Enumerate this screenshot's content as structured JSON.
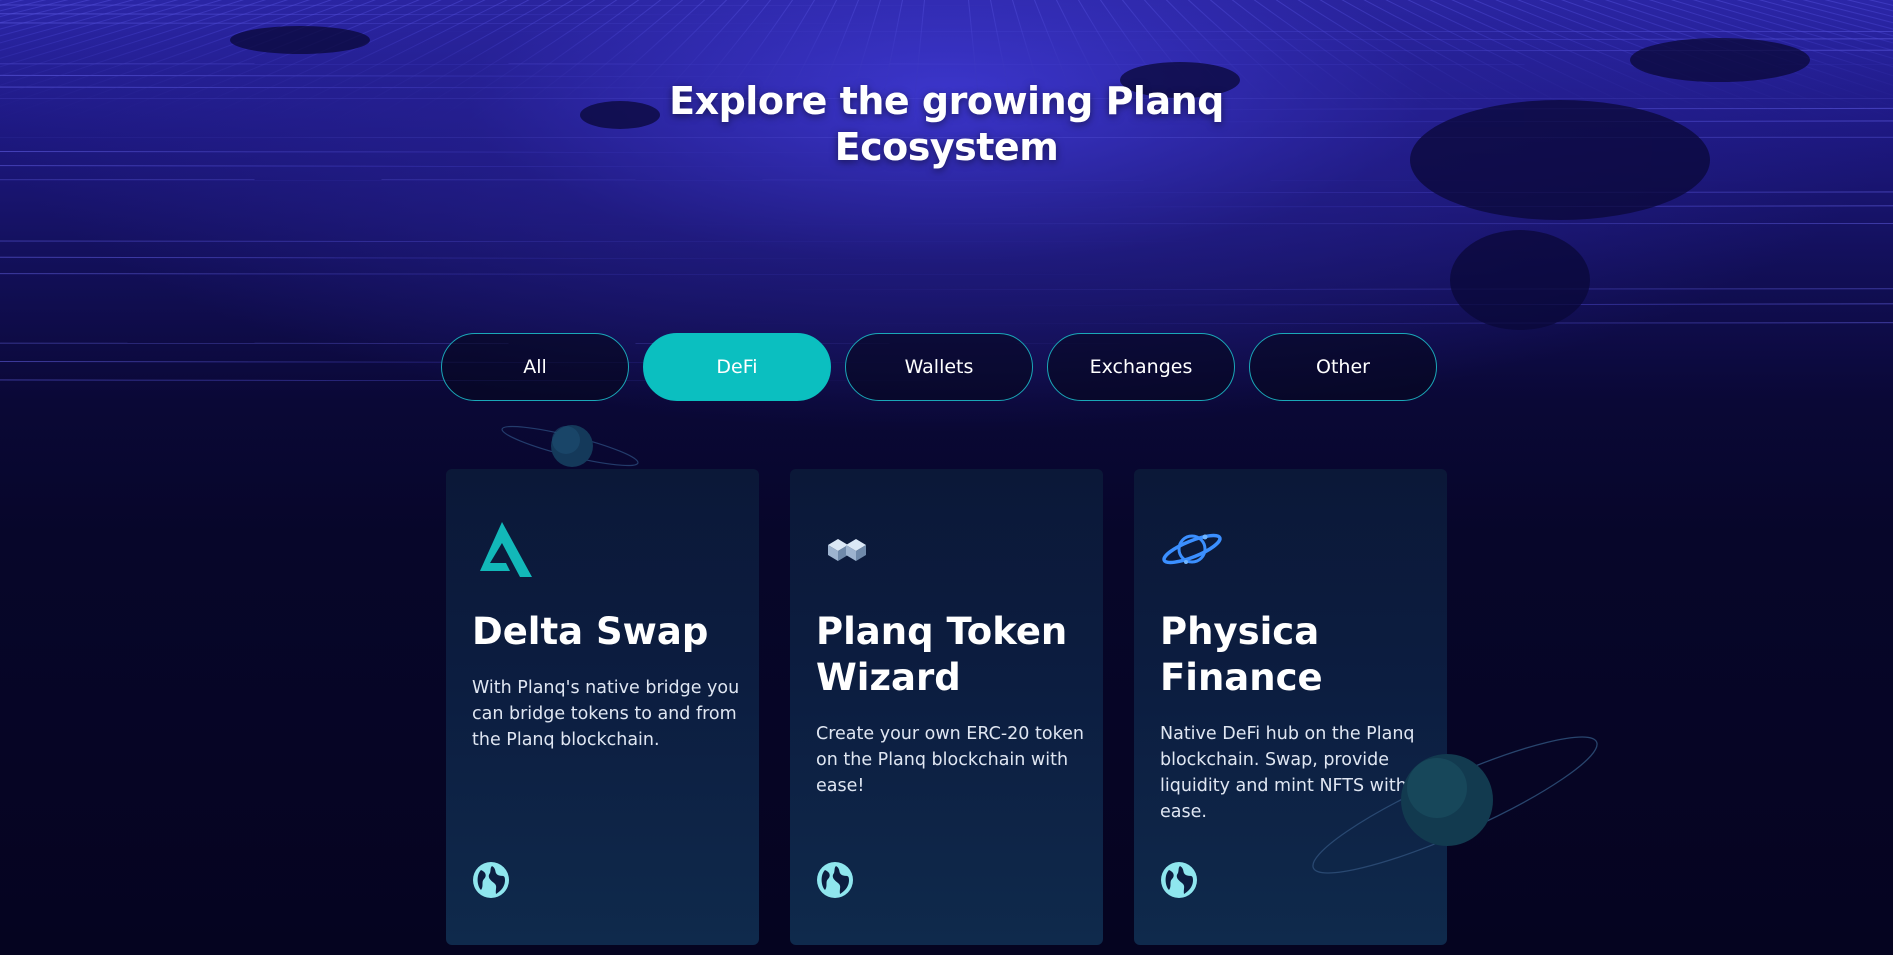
{
  "hero": {
    "title_line1": "Explore the growing Planq",
    "title_line2": "Ecosystem"
  },
  "filters": [
    {
      "label": "All",
      "active": false
    },
    {
      "label": "DeFi",
      "active": true
    },
    {
      "label": "Wallets",
      "active": false
    },
    {
      "label": "Exchanges",
      "active": false
    },
    {
      "label": "Other",
      "active": false
    }
  ],
  "cards": [
    {
      "title": "Delta Swap",
      "description": "With Planq's native bridge you can bridge tokens to and from the Planq blockchain.",
      "logo_icon": "delta-logo-icon",
      "link_icon": "globe-icon"
    },
    {
      "title": "Planq Token Wizard",
      "description": "Create your own ERC-20 token on the Planq blockchain with ease!",
      "logo_icon": "cubes-logo-icon",
      "link_icon": "globe-icon"
    },
    {
      "title": "Physica Finance",
      "description": "Native DeFi hub on the Planq blockchain. Swap, provide liquidity and mint NFTS with ease.",
      "logo_icon": "planet-logo-icon",
      "link_icon": "globe-icon"
    }
  ],
  "colors": {
    "accent": "#0bbfc0",
    "pill_border": "#1aa8b8",
    "background": "#07062a",
    "card_bg": "#0c1d40",
    "globe": "#8fe6ee"
  }
}
